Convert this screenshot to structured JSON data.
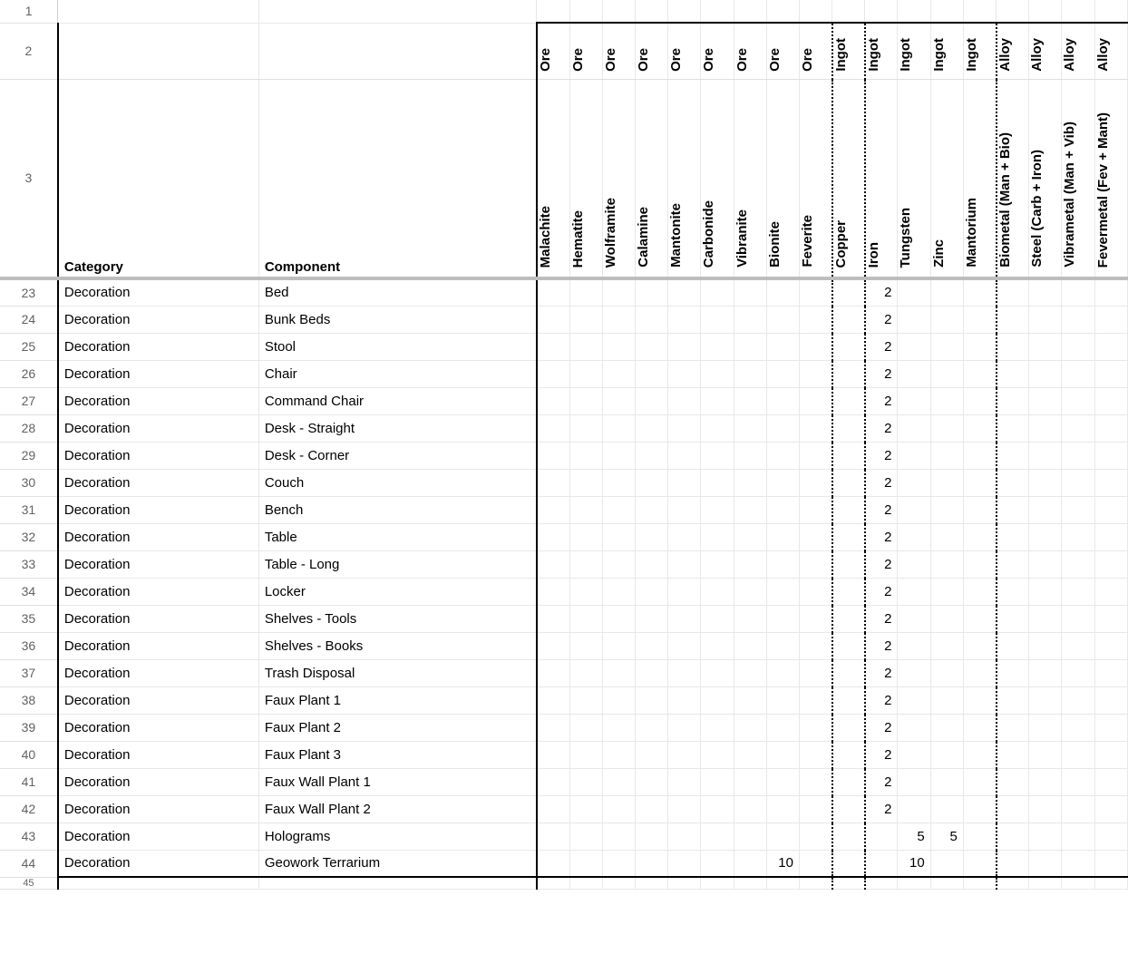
{
  "headers": {
    "category_label": "Category",
    "component_label": "Component"
  },
  "material_types": [
    "Ore",
    "Ore",
    "Ore",
    "Ore",
    "Ore",
    "Ore",
    "Ore",
    "Ore",
    "Ore",
    "Ingot",
    "Ingot",
    "Ingot",
    "Ingot",
    "Ingot",
    "Alloy",
    "Alloy",
    "Alloy",
    "Alloy"
  ],
  "material_names": [
    "Malachite",
    "Hematite",
    "Wolframite",
    "Calamine",
    "Mantonite",
    "Carbonide",
    "Vibranite",
    "Bionite",
    "Feverite",
    "Copper",
    "Iron",
    "Tungsten",
    "Zinc",
    "Mantorium",
    "Biometal (Man + Bio)",
    "Steel (Carb + Iron)",
    "Vibrametal (Man + Vib)",
    "Fevermetal (Fev + Mant)"
  ],
  "row_numbers": [
    23,
    24,
    25,
    26,
    27,
    28,
    29,
    30,
    31,
    32,
    33,
    34,
    35,
    36,
    37,
    38,
    39,
    40,
    41,
    42,
    43,
    44
  ],
  "rows": [
    {
      "category": "Decoration",
      "component": "Bed",
      "values": {
        "Iron": 2
      }
    },
    {
      "category": "Decoration",
      "component": "Bunk Beds",
      "values": {
        "Iron": 2
      }
    },
    {
      "category": "Decoration",
      "component": "Stool",
      "values": {
        "Iron": 2
      }
    },
    {
      "category": "Decoration",
      "component": "Chair",
      "values": {
        "Iron": 2
      }
    },
    {
      "category": "Decoration",
      "component": "Command Chair",
      "values": {
        "Iron": 2
      }
    },
    {
      "category": "Decoration",
      "component": "Desk - Straight",
      "values": {
        "Iron": 2
      }
    },
    {
      "category": "Decoration",
      "component": "Desk - Corner",
      "values": {
        "Iron": 2
      }
    },
    {
      "category": "Decoration",
      "component": "Couch",
      "values": {
        "Iron": 2
      }
    },
    {
      "category": "Decoration",
      "component": "Bench",
      "values": {
        "Iron": 2
      }
    },
    {
      "category": "Decoration",
      "component": "Table",
      "values": {
        "Iron": 2
      }
    },
    {
      "category": "Decoration",
      "component": "Table - Long",
      "values": {
        "Iron": 2
      }
    },
    {
      "category": "Decoration",
      "component": "Locker",
      "values": {
        "Iron": 2
      }
    },
    {
      "category": "Decoration",
      "component": "Shelves - Tools",
      "values": {
        "Iron": 2
      }
    },
    {
      "category": "Decoration",
      "component": "Shelves - Books",
      "values": {
        "Iron": 2
      }
    },
    {
      "category": "Decoration",
      "component": "Trash Disposal",
      "values": {
        "Iron": 2
      }
    },
    {
      "category": "Decoration",
      "component": "Faux Plant 1",
      "values": {
        "Iron": 2
      }
    },
    {
      "category": "Decoration",
      "component": "Faux Plant 2",
      "values": {
        "Iron": 2
      }
    },
    {
      "category": "Decoration",
      "component": "Faux Plant 3",
      "values": {
        "Iron": 2
      }
    },
    {
      "category": "Decoration",
      "component": "Faux Wall Plant 1",
      "values": {
        "Iron": 2
      }
    },
    {
      "category": "Decoration",
      "component": "Faux Wall Plant 2",
      "values": {
        "Iron": 2
      }
    },
    {
      "category": "Decoration",
      "component": "Holograms",
      "values": {
        "Tungsten": 5,
        "Zinc": 5
      }
    },
    {
      "category": "Decoration",
      "component": "Geowork Terrarium",
      "values": {
        "Bionite": 10,
        "Tungsten": 10
      }
    }
  ],
  "extra_row_number": 45
}
